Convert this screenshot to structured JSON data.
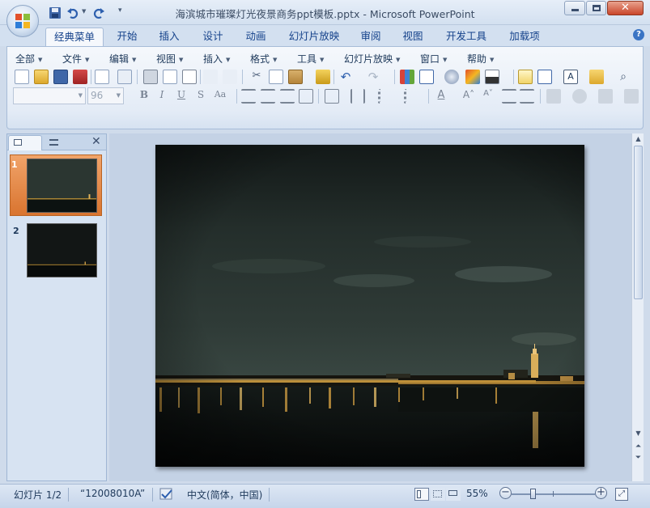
{
  "window": {
    "title": "海滨城市璀璨灯光夜景商务ppt模板.pptx - Microsoft PowerPoint"
  },
  "ribbon_tabs": [
    {
      "label": "经典菜单",
      "active": true
    },
    {
      "label": "开始"
    },
    {
      "label": "插入"
    },
    {
      "label": "设计"
    },
    {
      "label": "动画"
    },
    {
      "label": "幻灯片放映"
    },
    {
      "label": "审阅"
    },
    {
      "label": "视图"
    },
    {
      "label": "开发工具"
    },
    {
      "label": "加载项"
    }
  ],
  "menu": [
    "全部",
    "文件",
    "编辑",
    "视图",
    "插入",
    "格式",
    "工具",
    "幻灯片放映",
    "窗口",
    "帮助"
  ],
  "format": {
    "font_name": "",
    "font_size": "96"
  },
  "slides": [
    {
      "number": "1",
      "selected": true
    },
    {
      "number": "2"
    }
  ],
  "status": {
    "slide_info": "幻灯片 1/2",
    "theme": "“12008010A”",
    "language": "中文(简体，中国)",
    "zoom": "55%",
    "zoom_level": 0.55
  },
  "icons": {
    "office": "office-button-icon",
    "save": "save-icon",
    "undo": "undo-icon",
    "redo": "redo-icon",
    "help": "help-icon"
  },
  "colors": {
    "active_slide_thumb": "#e98a3d",
    "accent": "#15428b"
  }
}
